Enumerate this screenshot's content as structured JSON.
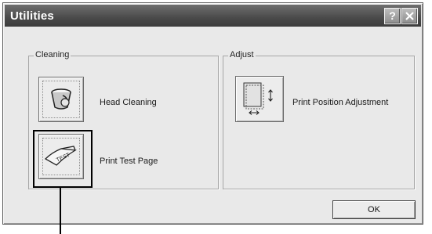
{
  "dialog": {
    "title": "Utilities",
    "help_icon": "help-icon",
    "close_icon": "close-icon",
    "help_glyph": "?"
  },
  "groups": {
    "cleaning": {
      "legend": "Cleaning",
      "items": [
        {
          "label": "Head Cleaning",
          "icon": "head-cleaning-icon"
        },
        {
          "label": "Print Test Page",
          "icon": "print-test-page-icon",
          "icon_text": "TEST"
        }
      ]
    },
    "adjust": {
      "legend": "Adjust",
      "items": [
        {
          "label": "Print Position Adjustment",
          "icon": "print-position-icon"
        }
      ]
    }
  },
  "buttons": {
    "ok": "OK"
  },
  "colors": {
    "titlebar": "#4a4a4a",
    "dialog_face": "#e9e9e9",
    "highlight": "#000000"
  }
}
